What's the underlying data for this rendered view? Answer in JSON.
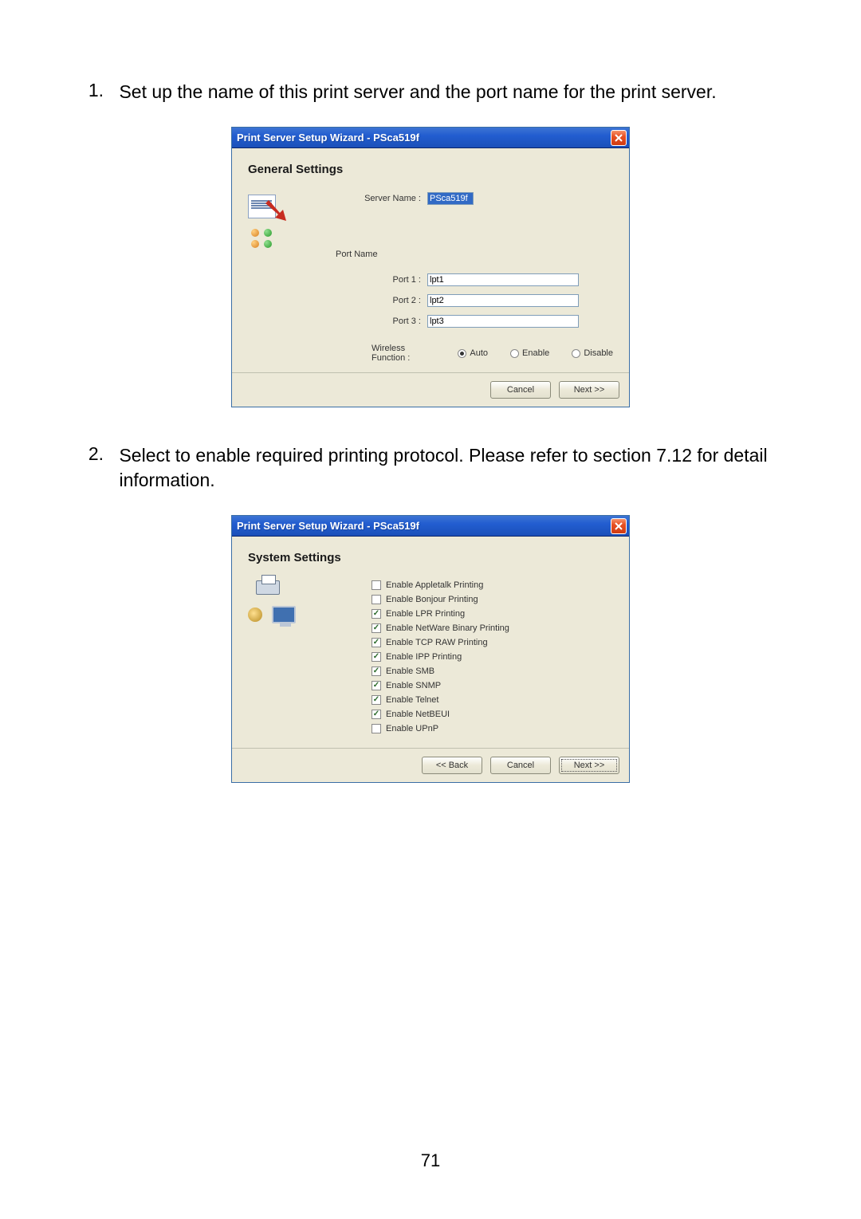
{
  "item1": {
    "number": "1.",
    "text": "Set up the name of this print server and the port name for the print server."
  },
  "dialog1": {
    "title": "Print Server Setup Wizard - PSca519f",
    "heading": "General Settings",
    "server_name_label": "Server Name :",
    "server_name_value": "PSca519f",
    "port_name_heading": "Port Name",
    "port1_label": "Port 1 :",
    "port1_value": "lpt1",
    "port2_label": "Port 2 :",
    "port2_value": "lpt2",
    "port3_label": "Port 3 :",
    "port3_value": "lpt3",
    "wireless_label": "Wireless Function :",
    "radio_auto": "Auto",
    "radio_enable": "Enable",
    "radio_disable": "Disable",
    "cancel": "Cancel",
    "next": "Next >>"
  },
  "item2": {
    "number": "2.",
    "text": "Select to enable required printing protocol. Please refer to section 7.12 for detail information."
  },
  "dialog2": {
    "title": "Print Server Setup Wizard - PSca519f",
    "heading": "System Settings",
    "options": [
      {
        "label": "Enable Appletalk Printing",
        "checked": false
      },
      {
        "label": "Enable Bonjour Printing",
        "checked": false
      },
      {
        "label": "Enable LPR Printing",
        "checked": true
      },
      {
        "label": "Enable NetWare Binary Printing",
        "checked": true
      },
      {
        "label": "Enable TCP RAW Printing",
        "checked": true
      },
      {
        "label": "Enable IPP Printing",
        "checked": true
      },
      {
        "label": "Enable SMB",
        "checked": true
      },
      {
        "label": "Enable SNMP",
        "checked": true
      },
      {
        "label": "Enable Telnet",
        "checked": true
      },
      {
        "label": "Enable NetBEUI",
        "checked": true
      },
      {
        "label": "Enable UPnP",
        "checked": false
      }
    ],
    "back": "<< Back",
    "cancel": "Cancel",
    "next": "Next >>"
  },
  "page_number": "71"
}
